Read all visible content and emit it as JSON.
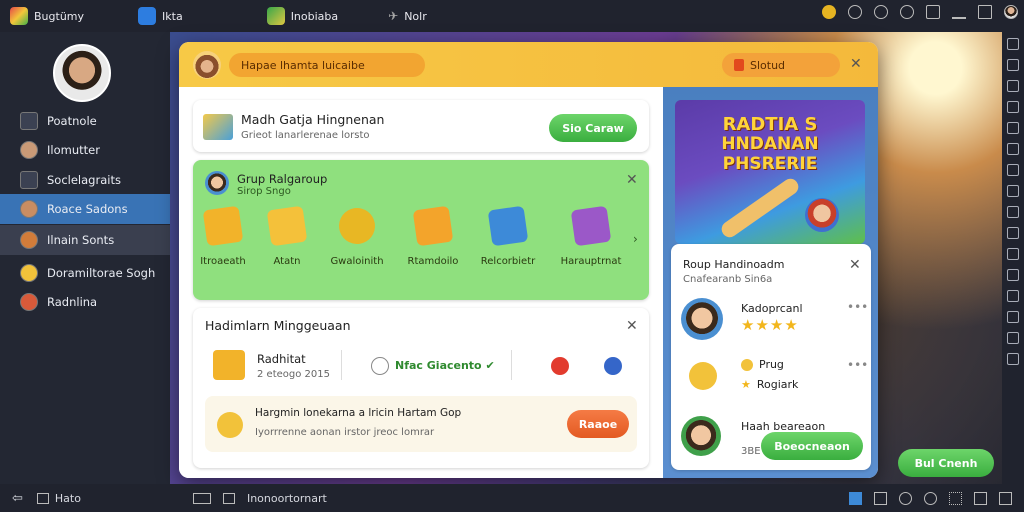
{
  "topbar": {
    "app": "Bugtümy",
    "tab1": "Ikta",
    "tab2": "Inobiaba"
  },
  "sidebar": {
    "items": [
      {
        "label": "Poatnole"
      },
      {
        "label": "Ilomutter"
      },
      {
        "label": "Soclelagraits"
      },
      {
        "label": "Roace Sadons"
      },
      {
        "label": "Ilnain Sonts"
      },
      {
        "label": "Doramiltorae Sogh"
      },
      {
        "label": "Radnlina"
      }
    ]
  },
  "dialog": {
    "header": {
      "pill_left": "Hapae lhamta luicaibe",
      "pill_right": "Slotud",
      "close": "✕"
    },
    "card1": {
      "title": "Madh Gatja Hingnenan",
      "sub": "Grieot lanarlerenae lorsto",
      "button": "Sio Caraw"
    },
    "group": {
      "title": "Grup Ralgaroup",
      "sub": "Sirop Sngo",
      "close": "✕",
      "more": "›",
      "gifts": [
        {
          "label": "Itroaeath",
          "color": "#f2b32a"
        },
        {
          "label": "Atatn",
          "color": "#f4c13a"
        },
        {
          "label": "Gwaloinith",
          "color": "#e8b724"
        },
        {
          "label": "Rtamdoilo",
          "color": "#f3a42b"
        },
        {
          "label": "Relcorbietr",
          "color": "#3d8ad8"
        },
        {
          "label": "Harauptrnat",
          "color": "#9b58c8"
        }
      ]
    },
    "card3": {
      "title": "Hadimlarn Minggeuaan",
      "close": "✕",
      "item_title": "Radhitat",
      "item_sub": "2 eteogo 2015",
      "status": "Nfac Giacento ✔"
    },
    "notice": {
      "title": "Hargmin lonekarna a lricin Hartam Gop",
      "sub": "Iyorrrenne aonan irstor jreoc lomrar",
      "button": "Raaoe"
    },
    "promo": {
      "line1": "RADTIA S",
      "line2": "HNDANAN",
      "line3": "PHSRERIE"
    },
    "friends": {
      "title": "Roup Handinoadm",
      "sub": "Cnafearanb Sin6a",
      "close": "✕",
      "f1_name": "Kadoprcanl",
      "f2_line1": "Prug",
      "f2_line2": "Rogiark",
      "f3_name": "Haah beareaon",
      "f3_sub": "3BE coor 2000",
      "f3_button": "Boeocneaon"
    },
    "install_button": "Bul Cnenh"
  },
  "bottombar": {
    "back": "Hato",
    "path": "Inonoortornart"
  },
  "colors": {
    "accent_green": "#3aae3f",
    "accent_orange": "#e35a22",
    "header_yellow": "#f7c946",
    "sidebar_active": "#3973b5"
  }
}
